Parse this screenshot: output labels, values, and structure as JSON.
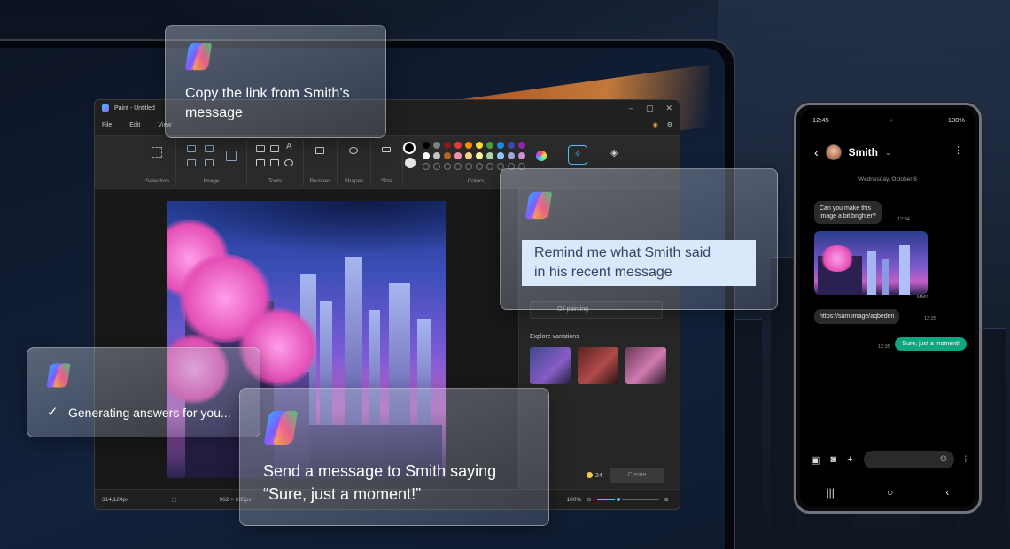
{
  "colors": {
    "accent": "#4cc2ff",
    "sent_bubble": "#0fa57e",
    "highlight": "#d9e8fb"
  },
  "paint": {
    "title": "Paint - Untitled",
    "menu": [
      "File",
      "Edit",
      "View"
    ],
    "window_controls": [
      "–",
      "▢",
      "✕"
    ],
    "groups": {
      "selection": "Selection",
      "image": "Image",
      "tools": "Tools",
      "brushes": "Brushes",
      "shapes": "Shapes",
      "size": "Size",
      "colors": "Colors"
    },
    "side": {
      "style_value": "Oil painting",
      "explore_label": "Explore variations",
      "credits": "24",
      "create_label": "Create"
    },
    "status": {
      "cursor": "314,124px",
      "dimensions": "962 × 635px",
      "zoom": "100%"
    },
    "zoom_level": 0.35
  },
  "cards": {
    "copy_link": "Copy the link from Smith’s message",
    "remind_line1": "Remind me what Smith said",
    "remind_line2": "in his recent message",
    "generating": "Generating answers for you...",
    "send_line1": "Send a message to Smith saying",
    "send_line2": "“Sure, just a moment!”"
  },
  "phone": {
    "time": "12:45",
    "battery": "100%",
    "contact": "Smith",
    "date": "Wednesday, October 6",
    "msg1_line1": "Can you make this",
    "msg1_line2": "image a bit brighter?",
    "msg1_time": "12:34",
    "mms_label": "MMS",
    "link": "https://sam.image/aqbeden",
    "link_time": "12:35",
    "reply": "Sure, just a moment!",
    "reply_time": "12:35"
  }
}
